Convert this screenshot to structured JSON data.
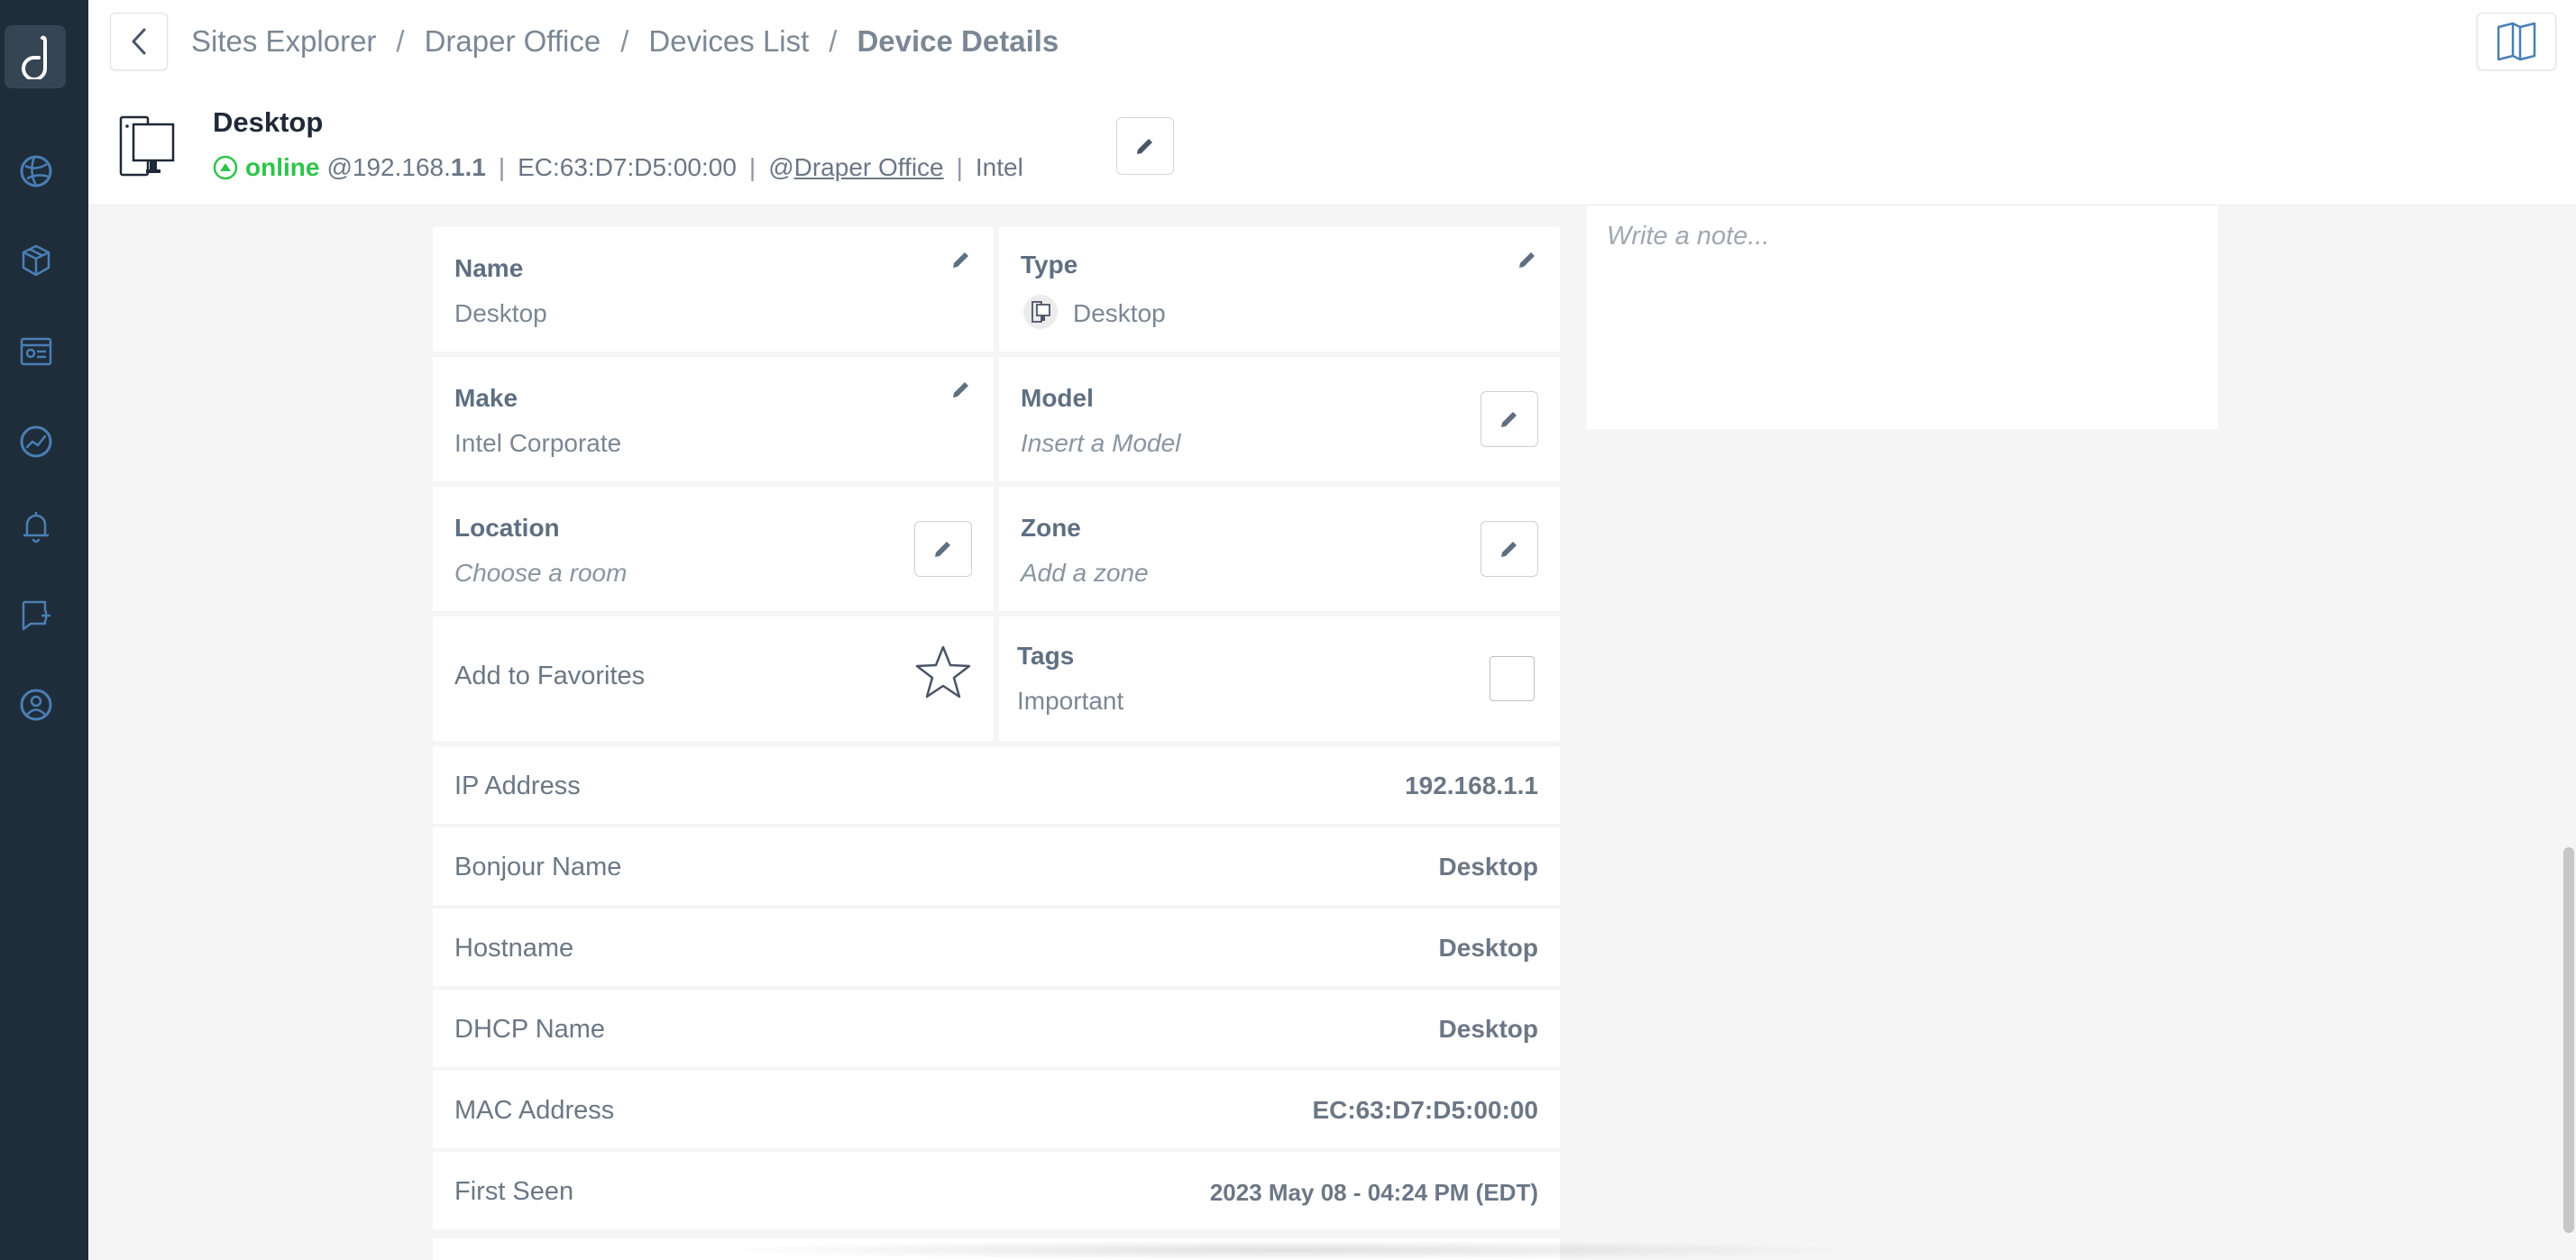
{
  "breadcrumb": {
    "items": [
      "Sites Explorer",
      "Draper Office",
      "Devices List"
    ],
    "current": "Device Details",
    "separator": "/"
  },
  "device": {
    "title": "Desktop",
    "status": "online",
    "ip_prefix": "@192.168.",
    "ip_suffix": "1.1",
    "mac": "EC:63:D7:D5:00:00",
    "site_prefix": "@",
    "site": "Draper Office",
    "vendor": "Intel",
    "status_color": "#2ec44a"
  },
  "cards": {
    "name": {
      "label": "Name",
      "value": "Desktop"
    },
    "type": {
      "label": "Type",
      "value": "Desktop"
    },
    "make": {
      "label": "Make",
      "value": "Intel Corporate"
    },
    "model": {
      "label": "Model",
      "placeholder": "Insert a Model"
    },
    "location": {
      "label": "Location",
      "placeholder": "Choose a room"
    },
    "zone": {
      "label": "Zone",
      "placeholder": "Add a zone"
    },
    "favorites": {
      "label": "Add to Favorites"
    },
    "tags": {
      "label": "Tags",
      "value": "Important"
    }
  },
  "details": [
    {
      "label": "IP Address",
      "value": "192.168.1.1"
    },
    {
      "label": "Bonjour Name",
      "value": "Desktop"
    },
    {
      "label": "Hostname",
      "value": "Desktop"
    },
    {
      "label": "DHCP Name",
      "value": "Desktop"
    },
    {
      "label": "MAC Address",
      "value": "EC:63:D7:D5:00:00"
    },
    {
      "label": "First Seen",
      "value": "2023 May 08 - 04:24 PM (EDT)"
    }
  ],
  "note": {
    "placeholder": "Write a note..."
  },
  "sidebar": {
    "items": [
      "globe-icon",
      "cube-icon",
      "id-card-icon",
      "chart-circle-icon",
      "bell-icon",
      "chat-plus-icon",
      "user-circle-icon"
    ]
  },
  "colors": {
    "sidebar": "#1f2d3a",
    "accent": "#4a7fb5",
    "online": "#2ec44a"
  }
}
